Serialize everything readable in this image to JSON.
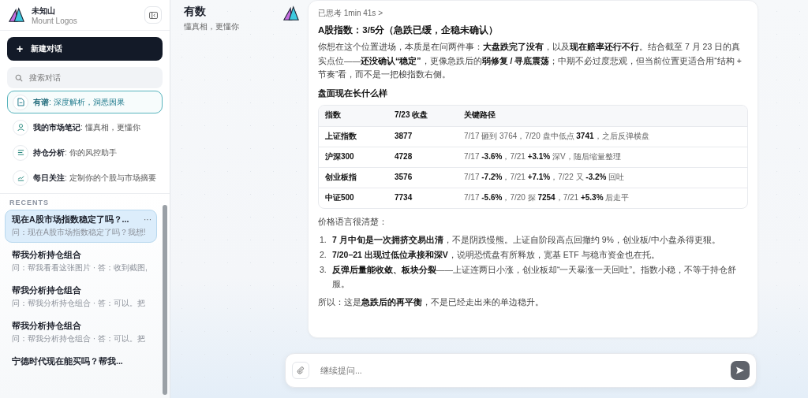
{
  "sidebar": {
    "brand": {
      "name": "未知山",
      "subtitle": "Mount Logos"
    },
    "new_chat": {
      "icon": "+",
      "label": "新建对话"
    },
    "search": {
      "placeholder": "搜索对话"
    },
    "modes": [
      {
        "kind": "doc",
        "name": "有谱",
        "desc": ": 深度解析，洞悉因果",
        "selected": true
      },
      {
        "kind": "person",
        "name": "我的市场笔记",
        "desc": ": 懂真相，更懂你",
        "selected": false
      },
      {
        "kind": "list",
        "name": "持仓分析",
        "desc": ": 你的风控助手",
        "selected": false
      },
      {
        "kind": "chart",
        "name": "每日关注",
        "desc": ": 定制你的个股与市场摘要",
        "selected": false
      }
    ],
    "recents_label": "RECENTS",
    "recents": [
      {
        "title": "现在A股市场指数稳定了吗？...",
        "preview": "问：现在A股市场指数稳定了吗？我想!",
        "selected": true,
        "more": "···"
      },
      {
        "title": "帮我分析持仓组合",
        "preview": "问：帮我看看这张图片 · 答：收到截图,",
        "selected": false
      },
      {
        "title": "帮我分析持仓组合",
        "preview": "问：帮我分析持仓组合 · 答：可以。把",
        "selected": false
      },
      {
        "title": "帮我分析持仓组合",
        "preview": "问：帮我分析持仓组合 · 答：可以。把",
        "selected": false
      },
      {
        "title": "宁德时代现在能买吗？帮我...",
        "selected": false
      }
    ]
  },
  "header": {
    "title": "有数",
    "subtitle": "懂真相，更懂你"
  },
  "message": {
    "thinking": "已思考 1min 41s  >",
    "title": "A股指数：3/5分（急跌已缓，企稳未确认）",
    "intro": "你想在这个位置进场，本质是在问两件事：**大盘跌完了没有**，以及**现在赔率还行不行**。结合截至 7 月 23 日的真实点位——**还没确认“稳定”**，更像急跌后的**弱修复 / 寻底震荡**；中期不必过度悲观，但当前位置更适合用“结构 + 节奏”看，而不是一把梭指数右侧。",
    "section": "盘面现在长什么样",
    "table": {
      "columns": [
        "指数",
        "7/23 收盘",
        "关键路径"
      ],
      "rows": [
        [
          "上证指数",
          "3877",
          "7/17 砸到 3764，7/20 盘中低点 **3741**，之后反弹横盘"
        ],
        [
          "沪深300",
          "4728",
          "7/17 **-3.6%**，7/21 **+3.1%** 深V，随后缩量整理"
        ],
        [
          "创业板指",
          "3576",
          "7/17 **-7.2%**，7/21 **+7.1%**，7/22 又 **-3.2%** 回吐"
        ],
        [
          "中证500",
          "7734",
          "7/17 **-5.6%**，7/20 探 **7254**，7/21 **+5.3%** 后走平"
        ]
      ]
    },
    "lead": "价格语言很清楚：",
    "points": [
      {
        "number": "1.",
        "text": "**7 月中旬是一次拥挤交易出清**，不是阴跌慢熊。上证自阶段高点回撤约 9%，创业板/中小盘杀得更狠。"
      },
      {
        "number": "2.",
        "text": "**7/20–21 出现过低位承接和深V**，说明恐慌盘有所释放，宽基 ETF 与稳市资金也在托。"
      },
      {
        "number": "3.",
        "text": "**反弹后量能收敛、板块分裂**——上证连两日小涨，创业板却“一天暴涨一天回吐”。指数小稳，不等于持仓舒服。"
      }
    ],
    "conclusion": "所以：这是**急跌后的再平衡**，不是已经走出来的单边稳升。"
  },
  "composer": {
    "placeholder": "继续提问..."
  }
}
